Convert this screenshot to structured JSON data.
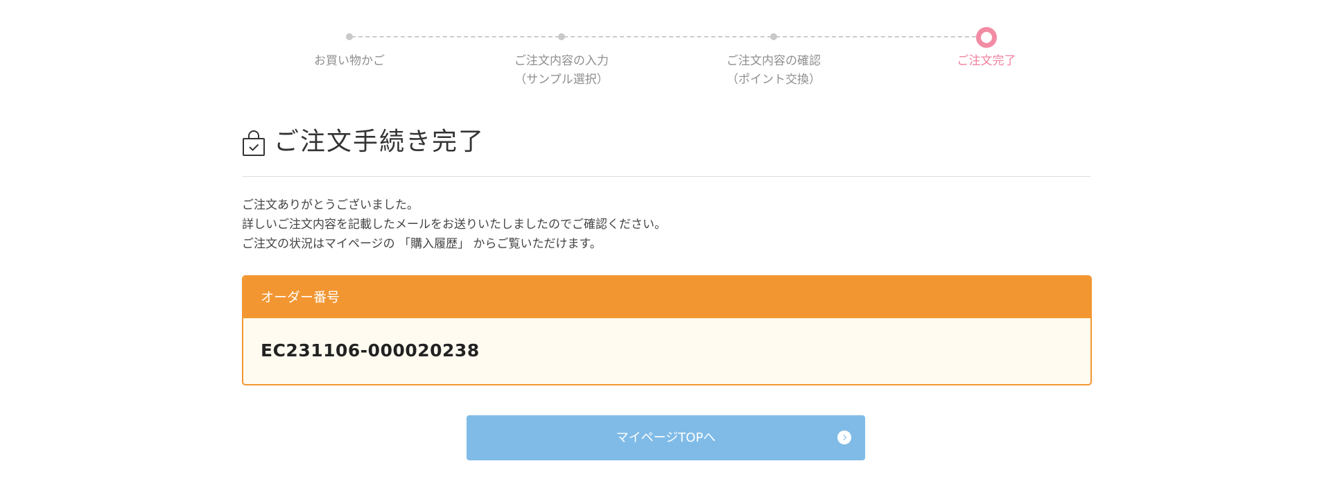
{
  "stepper": {
    "steps": [
      {
        "label": "お買い物かご",
        "state": "done"
      },
      {
        "label": "ご注文内容の入力\n（サンプル選択）",
        "state": "done"
      },
      {
        "label": "ご注文内容の確認\n（ポイント交換）",
        "state": "done"
      },
      {
        "label": "ご注文完了",
        "state": "current"
      }
    ],
    "current_color": "#f28ca4"
  },
  "heading": {
    "icon": "shopping-bag-check-icon",
    "title": "ご注文手続き完了"
  },
  "message": {
    "lines": [
      "ご注文ありがとうございました。",
      "詳しいご注文内容を記載したメールをお送りいたしましたのでご確認ください。",
      "ご注文の状況はマイページの 「購入履歴」 からご覧いただけます。"
    ]
  },
  "order": {
    "label": "オーダー番号",
    "number": "EC231106-000020238",
    "accent_color": "#f29632"
  },
  "button": {
    "label": "マイページTOPへ",
    "icon": "chevron-right-circle-icon",
    "color": "#80bbe7"
  }
}
